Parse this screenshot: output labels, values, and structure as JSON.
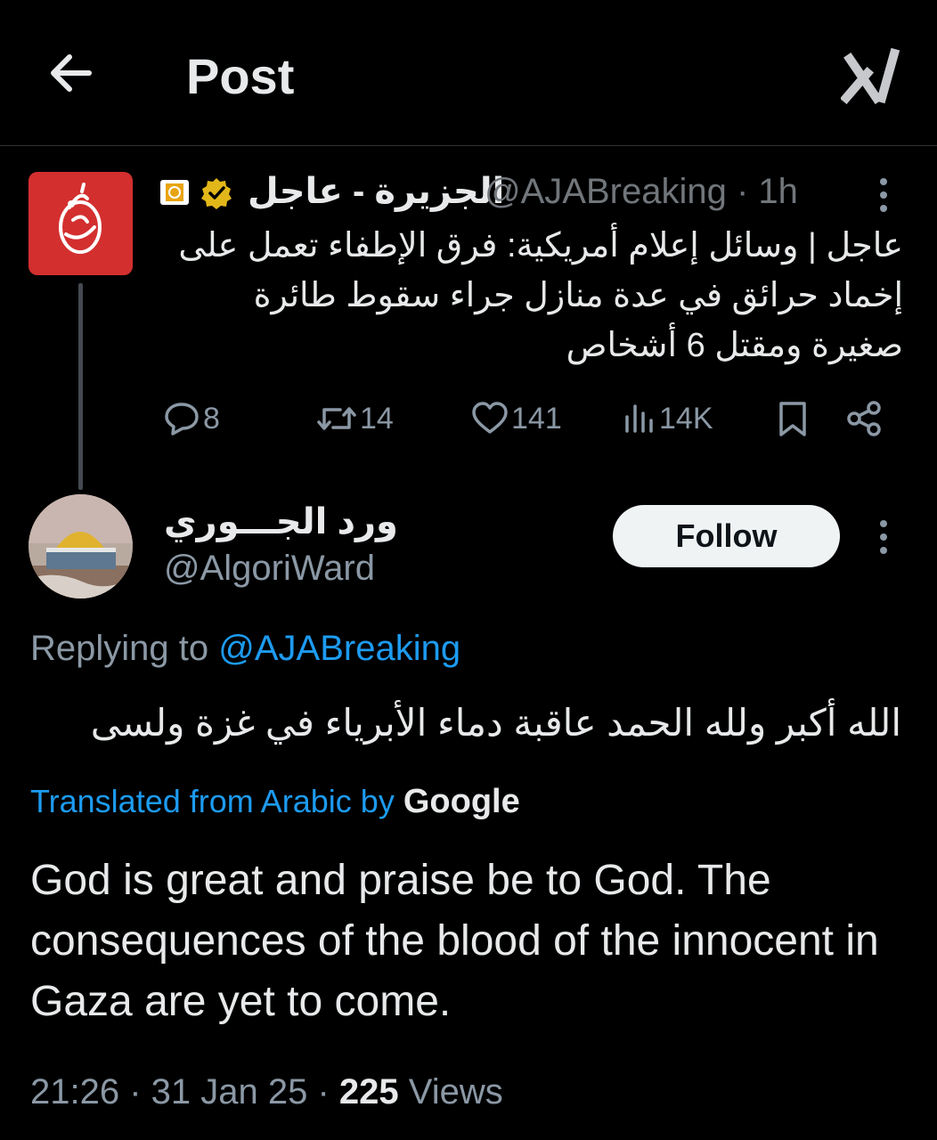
{
  "header": {
    "title": "Post",
    "back_icon": "arrow-left-icon",
    "grok_icon": "grok-icon"
  },
  "parent_tweet": {
    "author_name": "الجزيرة - عاجل",
    "handle": "@AJABreaking",
    "time_ago": "1h",
    "text": "عاجل | وسائل إعلام أمريكية: فرق الإطفاء تعمل على إخماد حرائق في عدة منازل جراء سقوط طائرة صغيرة ومقتل 6 أشخاص",
    "stats": {
      "replies": "8",
      "reposts": "14",
      "likes": "141",
      "views": "14K"
    },
    "avatar_color": "#d32f2f",
    "verified_color": "#e2b719"
  },
  "reply": {
    "author_name": "ورد الجـــوري",
    "handle": "@AlgoriWard",
    "follow_label": "Follow",
    "replying_prefix": "Replying to",
    "replying_handle": "@AJABreaking",
    "text_arabic": "الله أكبر ولله الحمد عاقبة دماء الأبرياء في غزة ولسى",
    "translated_label": "Translated from Arabic by",
    "translated_provider": "Google",
    "text_english": "God is great and praise be to God. The consequences of the blood of the innocent in Gaza are yet to come.",
    "time": "21:26",
    "date": "31 Jan 25",
    "views_count": "225",
    "views_label": "Views"
  },
  "colors": {
    "background": "#000000",
    "accent": "#1d9bf0",
    "secondary_text": "#8b98a5"
  }
}
